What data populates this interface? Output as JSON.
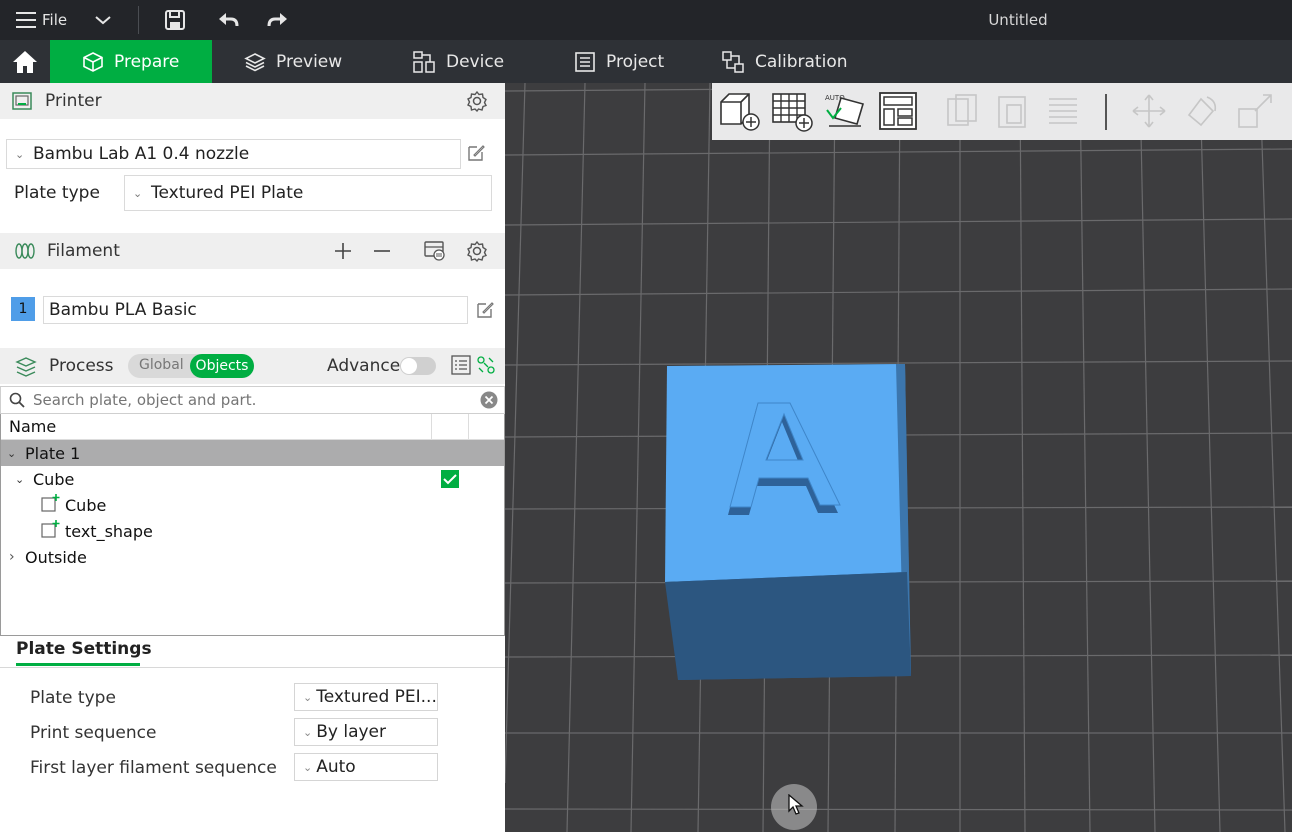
{
  "window": {
    "title": "Untitled"
  },
  "titlebar": {
    "file_label": "File"
  },
  "tabs": [
    {
      "label": "Prepare",
      "active": true
    },
    {
      "label": "Preview"
    },
    {
      "label": "Device"
    },
    {
      "label": "Project"
    },
    {
      "label": "Calibration"
    }
  ],
  "printer": {
    "section_label": "Printer",
    "selected": "Bambu Lab A1 0.4 nozzle",
    "plate_type_label": "Plate type",
    "plate_type_value": "Textured PEI Plate"
  },
  "filament": {
    "section_label": "Filament",
    "items": [
      {
        "index": "1",
        "name": "Bambu PLA Basic",
        "color": "#4f9de8"
      }
    ]
  },
  "process": {
    "section_label": "Process",
    "toggle_global": "Global",
    "toggle_objects": "Objects",
    "advance_label": "Advance",
    "advance_on": false
  },
  "search": {
    "placeholder": "Search plate, object and part."
  },
  "tree": {
    "header_name": "Name",
    "plate": "Plate 1",
    "object": "Cube",
    "object_checked": true,
    "parts": [
      "Cube",
      "text_shape"
    ],
    "outside": "Outside"
  },
  "plate_settings": {
    "tab_label": "Plate Settings",
    "rows": [
      {
        "label": "Plate type",
        "value": "Textured PEI..."
      },
      {
        "label": "Print sequence",
        "value": "By layer"
      },
      {
        "label": "First layer filament sequence",
        "value": "Auto"
      }
    ]
  },
  "viewport": {
    "object_letter": "A",
    "object_color": "#5aabf3",
    "auto_label": "AUTO"
  },
  "colors": {
    "accent": "#00ae42",
    "titlebar": "#232529",
    "tabbar": "#2e3136",
    "plate": "#3d3d3f"
  }
}
